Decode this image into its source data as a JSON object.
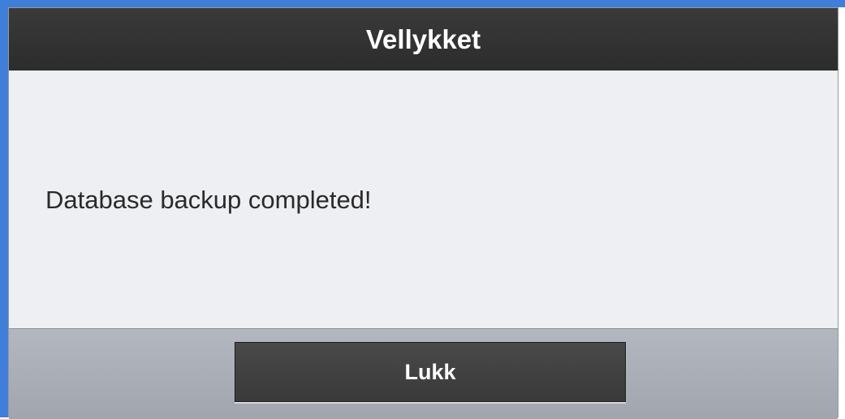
{
  "dialog": {
    "title": "Vellykket",
    "message": "Database backup completed!",
    "close_label": "Lukk"
  },
  "colors": {
    "header_bg": "#333333",
    "body_bg": "#eeeff3",
    "footer_bg": "#aaaeb6",
    "button_bg": "#424242",
    "accent_edge": "#3f7fd9"
  }
}
